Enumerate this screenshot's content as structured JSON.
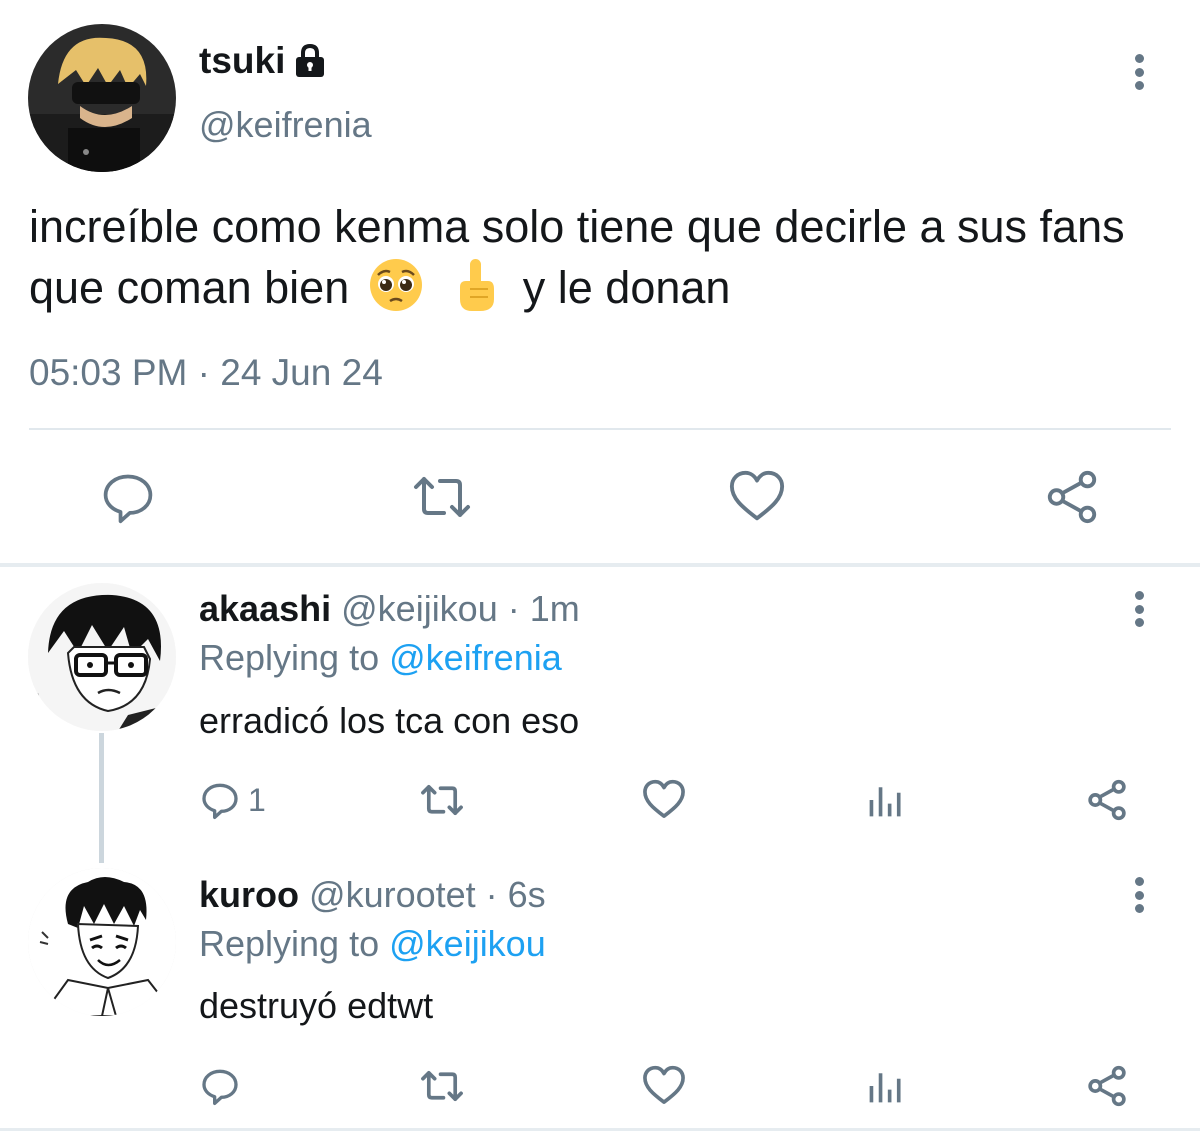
{
  "main_tweet": {
    "display_name": "tsuki",
    "handle": "@keifrenia",
    "text_before_emoji": "increíble como kenma solo tiene que decirle a sus fans que coman bien",
    "emojis": [
      "pleading-face",
      "index-pointing-up"
    ],
    "text_after_emoji": "y le donan",
    "timestamp": "05:03 PM · 24 Jun 24",
    "icons": [
      "reply-icon",
      "retweet-icon",
      "like-icon",
      "share-icon"
    ]
  },
  "replies": [
    {
      "display_name": "akaashi",
      "handle_time": "@keijikou · 1m",
      "replying_to_label": "Replying to",
      "replying_to_handle": "@keifrenia",
      "text": "erradicó los tca con eso",
      "reply_count": "1"
    },
    {
      "display_name": "kuroo",
      "handle_time": "@kurootet · 6s",
      "replying_to_label": "Replying to",
      "replying_to_handle": "@keijikou",
      "text": "destruyó edtwt",
      "reply_count": ""
    }
  ],
  "colors": {
    "icon_gray": "#657786",
    "link_blue": "#1da1f2",
    "text_dark": "#14171a",
    "divider": "#e1e8ed"
  }
}
